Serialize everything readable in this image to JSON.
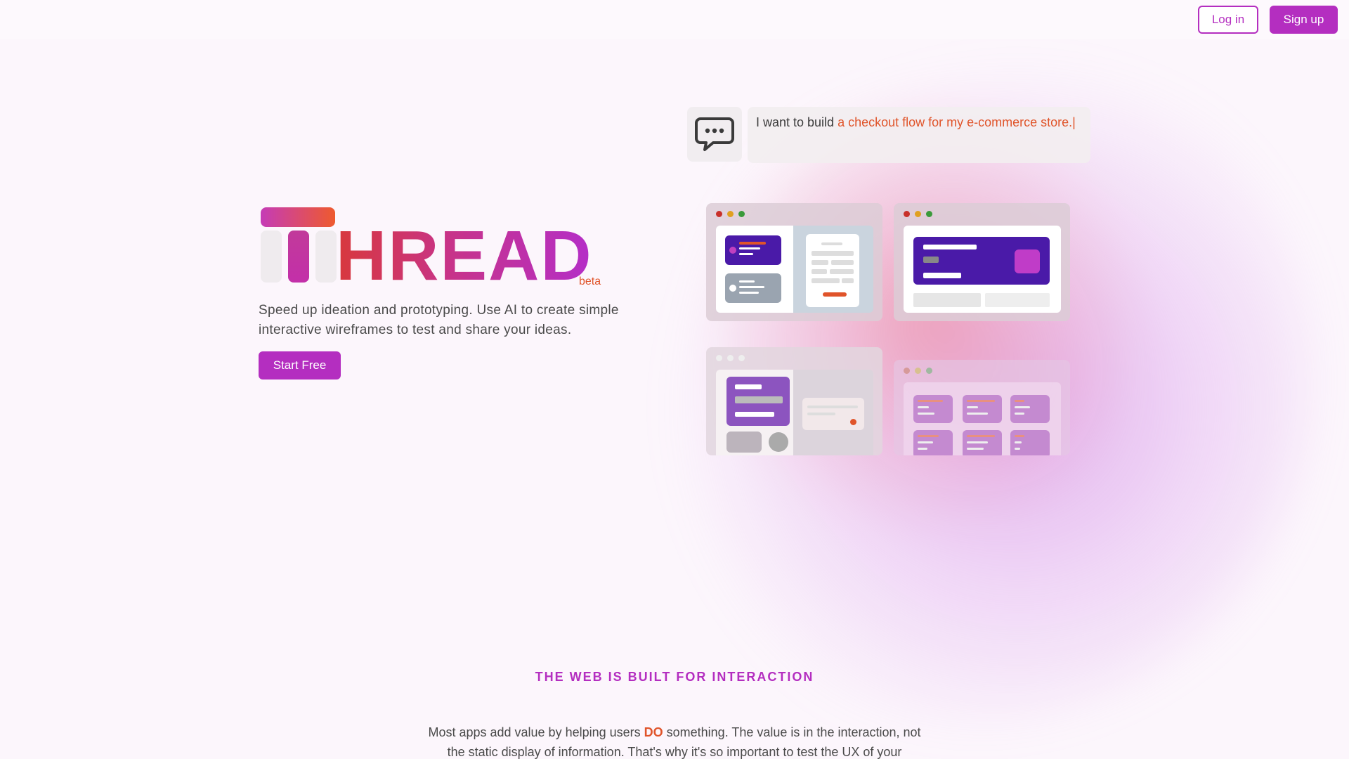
{
  "nav": {
    "login_label": "Log in",
    "signup_label": "Sign up"
  },
  "hero": {
    "logo_text": "HREAD",
    "beta_label": "beta",
    "tagline": "Speed up ideation and prototyping. Use AI to create simple interactive wireframes to test and share your ideas.",
    "cta_label": "Start Free"
  },
  "prompt": {
    "icon": "chat-bubble-icon",
    "prefix": "I want to build ",
    "highlight": "a checkout flow for my e-commerce store.|"
  },
  "section": {
    "title": "THE WEB IS BUILT FOR INTERACTION",
    "body_before": "Most apps add value by helping users ",
    "body_emphasis": "DO",
    "body_after": " something. The value is in the interaction, not the static display of information. That's why it's so important to test the UX of your"
  },
  "colors": {
    "brand": "#b42ec0",
    "accent": "#e0542a",
    "background": "#fcf6fc"
  }
}
